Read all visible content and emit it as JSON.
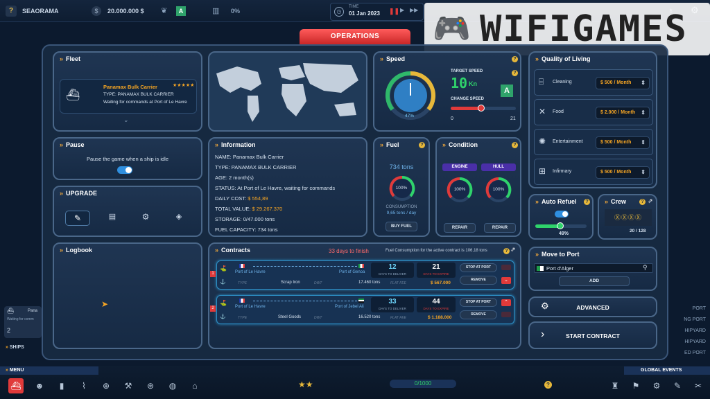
{
  "topbar": {
    "help": "?",
    "company": "SEAORAMA",
    "money": "20.000.000 $",
    "grade": "A",
    "percent": "0%",
    "time_label": "TIME",
    "date": "01 Jan 2023",
    "speeds": [
      "1",
      "2",
      "3"
    ]
  },
  "watermark": {
    "text": "WIFIGAMES"
  },
  "operations_tab": "OPERATIONS",
  "fleet": {
    "title": "Fleet",
    "ship_name": "Panamax Bulk Carrier",
    "ship_type": "TYPE: PANAMAX BULK CARRIER",
    "ship_status": "Waiting for commands at Port of Le Havre",
    "stars": "★★★★★"
  },
  "pause": {
    "title": "Pause",
    "text": "Pause the game when a ship is idle",
    "enabled": true
  },
  "upgrade": {
    "title": "UPGRADE"
  },
  "logbook": {
    "title": "Logbook"
  },
  "information": {
    "title": "Information",
    "name": "NAME: Panamax Bulk Carrier",
    "type": "TYPE: PANAMAX BULK CARRIER",
    "age": "AGE: 2 month(s)",
    "status": "STATUS: At Port of Le Havre, waiting for commands",
    "daily_cost_label": "DAILY COST:",
    "daily_cost": "$ 554,89",
    "total_value_label": "TOTAL VALUE:",
    "total_value": "$ 29.267.370",
    "storage": "STORAGE: 0/47.000 tons",
    "fuel_capacity": "FUEL CAPACITY: 734 tons"
  },
  "speed": {
    "title": "Speed",
    "gauge_percent": "47%",
    "target_label": "TARGET SPEED",
    "target_value": "10",
    "target_unit": "Kn",
    "grade": "A",
    "change_label": "CHANGE SPEED",
    "min": "0",
    "max": "21",
    "slider_fraction": 0.47
  },
  "fuel": {
    "title": "Fuel",
    "tons": "734 tons",
    "percent": "100%",
    "consumption_label": "CONSUMPTION",
    "consumption": "9,65 tons / day",
    "buy_label": "BUY FUEL"
  },
  "condition": {
    "title": "Condition",
    "engine_label": "ENGINE",
    "hull_label": "HULL",
    "engine_percent": "100%",
    "hull_percent": "100%",
    "repair_label": "REPAIR"
  },
  "contracts": {
    "title": "Contracts",
    "days_to_finish": "33 days to finish",
    "fuel_note": "Fuel Consumption for the active contract is 106,18 tons",
    "days_label": "DAYS TO DELIVER",
    "stop_label": "STOP AT PORT",
    "remove_label": "REMOVE",
    "type_label": "TYPE",
    "dwt_label": "DWT",
    "fee_label": "FLAT FEE",
    "items": [
      {
        "num": "1",
        "from": "Port of Le Havre",
        "to": "Port of Genoa",
        "days": "12",
        "second": "21",
        "second_label": "DAYS TO EXPIRE",
        "cargo": "Scrap Iron",
        "dwt": "17.460 tons",
        "fee": "$ 567.000"
      },
      {
        "num": "2",
        "from": "Port of Le Havre",
        "to": "Port of Jebel Ali",
        "days": "33",
        "second": "44",
        "second_label": "DAYS TO EXPIRE",
        "cargo": "Steel Goods",
        "dwt": "16.520 tons",
        "fee": "$ 1.188.000"
      }
    ]
  },
  "quality": {
    "title": "Quality of Living",
    "items": [
      {
        "label": "Cleaning",
        "value": "$ 500 / Month"
      },
      {
        "label": "Food",
        "value": "$ 2.000 / Month"
      },
      {
        "label": "Entertainment",
        "value": "$ 500 / Month"
      },
      {
        "label": "Infirmary",
        "value": "$ 500 / Month"
      }
    ]
  },
  "auto_refuel": {
    "title": "Auto Refuel",
    "percent": "49%",
    "fraction": 0.49,
    "enabled": true
  },
  "crew": {
    "title": "Crew",
    "count": "20 / 128"
  },
  "move_to_port": {
    "title": "Move to Port",
    "port": "Port d'Alger",
    "add_label": "ADD"
  },
  "advanced_label": "ADVANCED",
  "start_contract_label": "START CONTRACT",
  "left_side": {
    "ship": "Pana",
    "status": "Waiting for comm",
    "ships_label": "SHIPS",
    "count": "2"
  },
  "right_side": [
    "PORT",
    "NG PORT",
    "HIPYARD",
    "HIPYARD",
    "ED PORT"
  ],
  "bottom": {
    "menu_label": "MENU",
    "global_label": "GLOBAL EVENTS",
    "progress": "0/1000"
  },
  "colors": {
    "accent": "#f5a524",
    "ops_red": "#e03a3a",
    "panel_border": "#4a6789",
    "green": "#2fd36b"
  }
}
